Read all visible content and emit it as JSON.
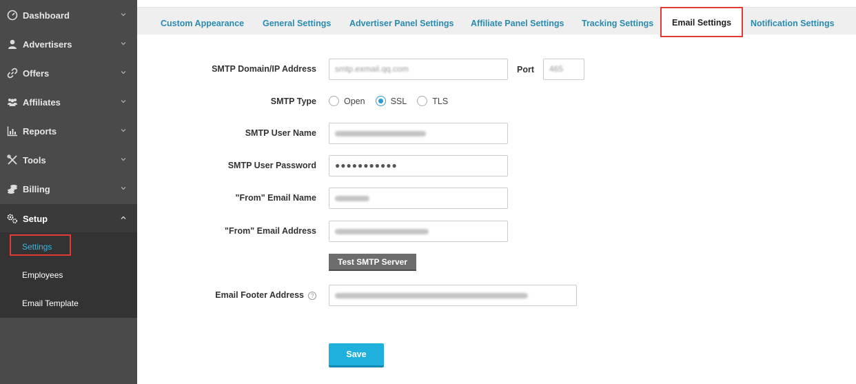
{
  "sidebar": {
    "items": [
      {
        "label": "Dashboard"
      },
      {
        "label": "Advertisers"
      },
      {
        "label": "Offers"
      },
      {
        "label": "Affiliates"
      },
      {
        "label": "Reports"
      },
      {
        "label": "Tools"
      },
      {
        "label": "Billing"
      },
      {
        "label": "Setup"
      }
    ],
    "sub_items": [
      {
        "label": "Settings"
      },
      {
        "label": "Employees"
      },
      {
        "label": "Email Template"
      }
    ]
  },
  "tabs": [
    {
      "label": "Custom Appearance"
    },
    {
      "label": "General Settings"
    },
    {
      "label": "Advertiser Panel Settings"
    },
    {
      "label": "Affiliate Panel Settings"
    },
    {
      "label": "Tracking Settings"
    },
    {
      "label": "Email Settings"
    },
    {
      "label": "Notification Settings"
    }
  ],
  "form": {
    "smtp_domain": {
      "label": "SMTP Domain/IP Address",
      "value": "smtp.exmail.qq.com"
    },
    "port": {
      "label": "Port",
      "value": "465"
    },
    "smtp_type": {
      "label": "SMTP Type",
      "options": [
        "Open",
        "SSL",
        "TLS"
      ],
      "selected": "SSL"
    },
    "user_name": {
      "label": "SMTP User Name"
    },
    "password": {
      "label": "SMTP User Password",
      "value": "●●●●●●●●●●●"
    },
    "from_name": {
      "label": "\"From\" Email Name"
    },
    "from_address": {
      "label": "\"From\" Email Address"
    },
    "test_button": "Test SMTP Server",
    "footer_address": {
      "label": "Email Footer Address",
      "help": "?"
    },
    "save_button": "Save"
  }
}
